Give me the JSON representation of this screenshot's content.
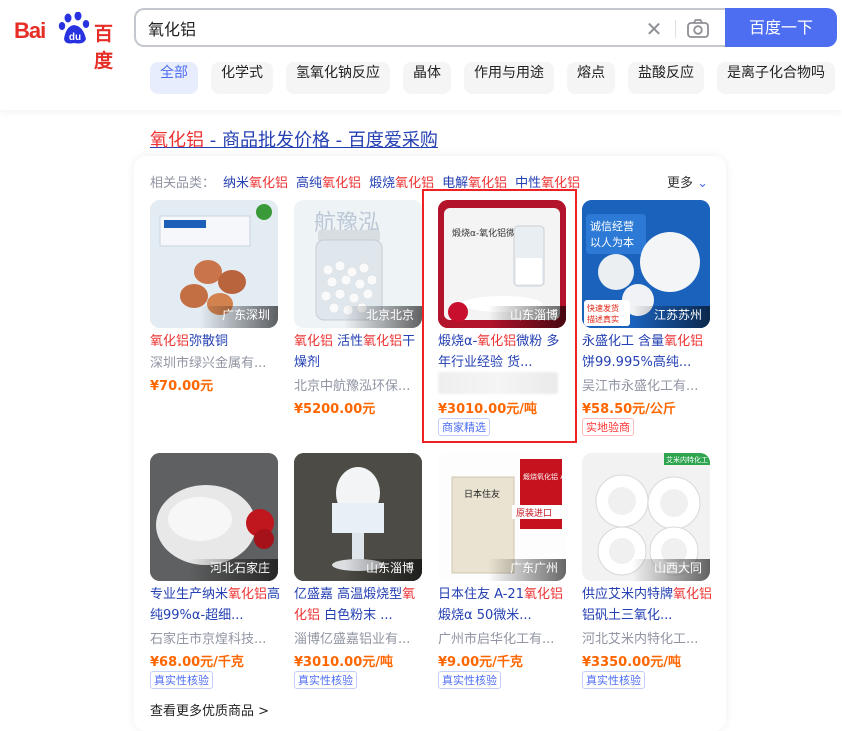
{
  "logo": {
    "text_left": "Bai",
    "text_mid": "du",
    "text_right": "百度"
  },
  "search": {
    "value": "氧化铝",
    "button_label": "百度一下"
  },
  "tabs": [
    {
      "label": "全部",
      "active": true
    },
    {
      "label": "化学式"
    },
    {
      "label": "氢氧化钠反应"
    },
    {
      "label": "晶体"
    },
    {
      "label": "作用与用途"
    },
    {
      "label": "熔点"
    },
    {
      "label": "盐酸反应"
    },
    {
      "label": "是离子化合物吗"
    }
  ],
  "result": {
    "title_highlight": "氧化铝",
    "title_rest": " - 商品批发价格 - 百度爱采购"
  },
  "related": {
    "prefix": "相关品类：",
    "items": [
      {
        "pre": "纳米",
        "hl": "氧化铝"
      },
      {
        "pre": "高纯",
        "hl": "氧化铝"
      },
      {
        "pre": "煅烧",
        "hl": "氧化铝"
      },
      {
        "pre": "电解",
        "hl": "氧化铝"
      },
      {
        "pre": "中性",
        "hl": "氧化铝"
      }
    ],
    "more_label": "更多"
  },
  "products": [
    {
      "location": "广东深圳",
      "t1h": "氧化铝",
      "t1": "弥散铜",
      "shop": "深圳市绿兴金属有...",
      "price": "¥70.00元",
      "badge": ""
    },
    {
      "location": "北京北京",
      "t1h": "氧化铝",
      "t1": " 活性",
      "t2h": "氧化铝",
      "t2": "干燥剂",
      "shop": "北京中航豫泓环保...",
      "price": "¥5200.00元",
      "badge": ""
    },
    {
      "location": "山东淄博",
      "t1": "煅烧α-",
      "t1h": "氧化铝",
      "t2": "微粉 多年行业经验 货...",
      "shop": "",
      "price": "¥3010.00元/吨",
      "badge": "商家精选",
      "thumb_text": "煅烧α-氧化铝微粉"
    },
    {
      "location": "江苏苏州",
      "t1": "永盛化工 含量",
      "t1h": "氧化铝",
      "t2": "饼99.995%高纯...",
      "shop": "吴江市永盛化工有...",
      "price": "¥58.50元/公斤",
      "badge": "实地验商",
      "thumb_text1": "诚信经营",
      "thumb_text2": "以人为本",
      "thumb_text3": "快速发货",
      "thumb_text4": "描述真实"
    },
    {
      "location": "河北石家庄",
      "t1": "专业生产纳米",
      "t1h": "氧化铝",
      "t2": "高纯99%α-超细...",
      "shop": "石家庄市京煌科技...",
      "price": "¥68.00元/千克",
      "badge": "真实性核验"
    },
    {
      "location": "山东淄博",
      "t1": "亿盛嘉 高温煅烧型",
      "t1h": "氧化铝",
      "t2": " 白色粉末 ...",
      "shop": "淄博亿盛嘉铝业有...",
      "price": "¥3010.00元/吨",
      "badge": "真实性核验"
    },
    {
      "location": "广东广州",
      "t1": "日本住友 A-21",
      "t1h": "氧化铝",
      "t2": "煅烧α 50微米...",
      "shop": "广州市启华化工有...",
      "price": "¥9.00元/千克",
      "badge": "真实性核验",
      "thumb_text": "煅烧氧化铝 A-21",
      "thumb_sub": "日本住友",
      "thumb_tag": "原装进口"
    },
    {
      "location": "山西大同",
      "t1": "供应艾米内特牌",
      "t1h": "氧化",
      "t2h": "铝",
      "t2": "铝矾土三氧化...",
      "shop": "河北艾米内特化工...",
      "price": "¥3350.00元/吨",
      "badge": "真实性核验",
      "thumb_text": "艾米内特化工"
    }
  ],
  "footer": {
    "more_link": "查看更多优质商品 >"
  },
  "colors": {
    "brand_blue": "#4e6ef2",
    "link_blue": "#2440b3",
    "highlight_red": "#e33",
    "price_orange": "#f60",
    "logo_red": "#e62e27"
  }
}
